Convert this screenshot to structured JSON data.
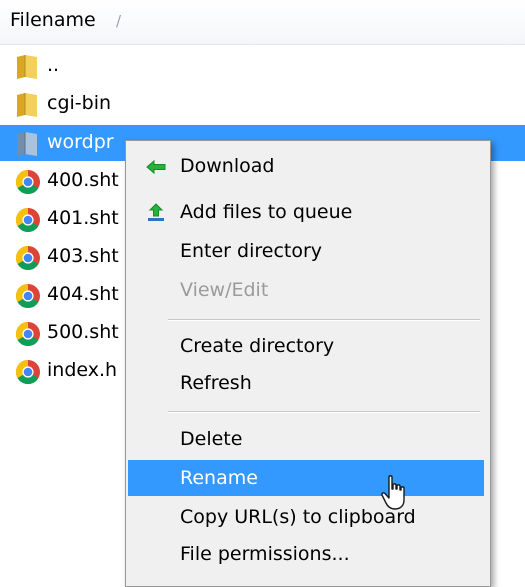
{
  "header": {
    "column_label": "Filename",
    "sort_indicator": "/"
  },
  "files": [
    {
      "name": "..",
      "icon": "folder-icon"
    },
    {
      "name": "cgi-bin",
      "icon": "folder-icon"
    },
    {
      "name": "wordpr",
      "icon": "folder-icon",
      "selected": true
    },
    {
      "name": "400.sht",
      "icon": "chrome-file-icon"
    },
    {
      "name": "401.sht",
      "icon": "chrome-file-icon"
    },
    {
      "name": "403.sht",
      "icon": "chrome-file-icon"
    },
    {
      "name": "404.sht",
      "icon": "chrome-file-icon"
    },
    {
      "name": "500.sht",
      "icon": "chrome-file-icon"
    },
    {
      "name": "index.h",
      "icon": "chrome-file-icon"
    }
  ],
  "context_menu": {
    "items": [
      {
        "label": "Download",
        "icon": "download-arrow-icon"
      },
      {
        "label": "Add files to queue",
        "icon": "add-to-queue-icon"
      },
      {
        "label": "Enter directory"
      },
      {
        "label": "View/Edit",
        "disabled": true
      },
      {
        "label": "Create directory"
      },
      {
        "label": "Refresh"
      },
      {
        "label": "Delete"
      },
      {
        "label": "Rename",
        "highlighted": true
      },
      {
        "label": "Copy URL(s) to clipboard"
      },
      {
        "label": "File permissions..."
      }
    ]
  },
  "colors": {
    "selection": "#3399ff",
    "menu_background": "#f0f0f0",
    "disabled_text": "#9b9b9b"
  }
}
